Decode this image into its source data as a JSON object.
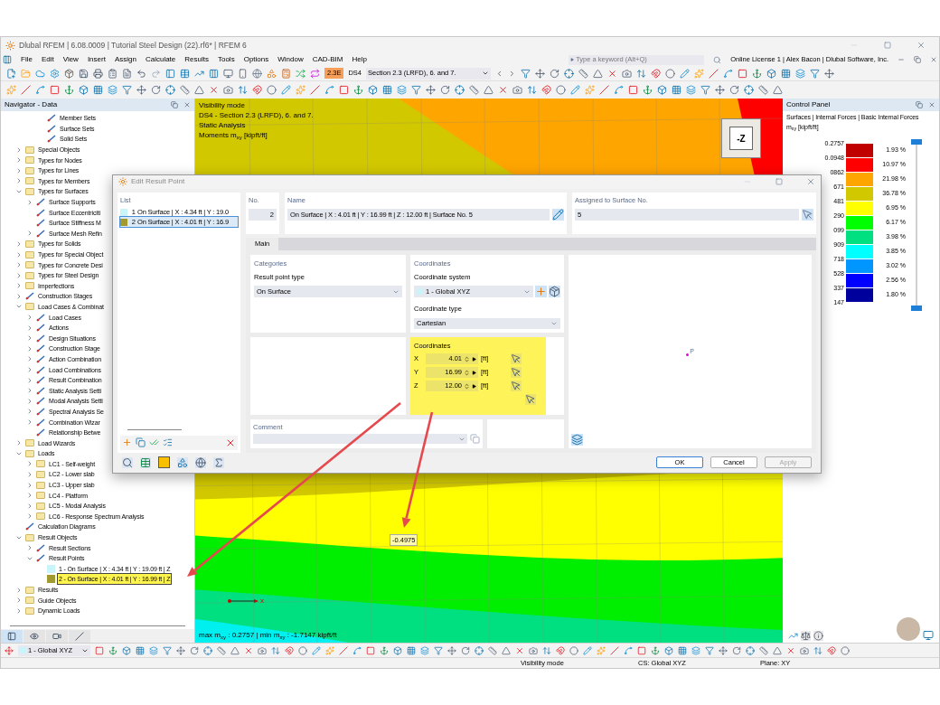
{
  "window": {
    "title": "Dlubal RFEM | 6.08.0009 | Tutorial Steel Design (22).rf6* | RFEM 6"
  },
  "menu": [
    "File",
    "Edit",
    "View",
    "Insert",
    "Assign",
    "Calculate",
    "Results",
    "Tools",
    "Options",
    "Window",
    "CAD-BIM",
    "Help"
  ],
  "search": {
    "placeholder": "Type a keyword (Alt+Q)"
  },
  "license": "Online License 1 | Alex Bacon | Dlubal Software, Inc.",
  "toolbar": {
    "badge": "2.3E",
    "design_situation": "DS4",
    "combo": "Section 2.3 (LRFD), 6. and 7."
  },
  "navigator": {
    "title": "Navigator - Data",
    "partial_items": [
      {
        "label": "Member Sets",
        "kind": "object"
      },
      {
        "label": "Surface Sets",
        "kind": "object"
      },
      {
        "label": "Solid Sets",
        "kind": "object"
      }
    ],
    "tree": [
      {
        "label": "Special Objects",
        "kind": "folder",
        "expanded": false
      },
      {
        "label": "Types for Nodes",
        "kind": "folder",
        "expanded": false
      },
      {
        "label": "Types for Lines",
        "kind": "folder",
        "expanded": false
      },
      {
        "label": "Types for Members",
        "kind": "folder",
        "expanded": false
      },
      {
        "label": "Types for Surfaces",
        "kind": "folder",
        "expanded": true,
        "children": [
          {
            "label": "Surface Supports",
            "kind": "object",
            "expanded": false
          },
          {
            "label": "Surface Eccentriciti",
            "kind": "object"
          },
          {
            "label": "Surface Stiffness M",
            "kind": "object"
          },
          {
            "label": "Surface Mesh Refin",
            "kind": "object",
            "expanded": false
          }
        ]
      },
      {
        "label": "Types for Solids",
        "kind": "folder",
        "expanded": false
      },
      {
        "label": "Types for Special Object",
        "kind": "folder",
        "expanded": false
      },
      {
        "label": "Types for Concrete Desi",
        "kind": "folder",
        "expanded": false
      },
      {
        "label": "Types for Steel Design",
        "kind": "folder",
        "expanded": false
      },
      {
        "label": "Imperfections",
        "kind": "folder",
        "expanded": false
      },
      {
        "label": "Construction Stages",
        "kind": "object",
        "expanded": false
      },
      {
        "label": "Load Cases & Combinat",
        "kind": "folder",
        "expanded": true,
        "children": [
          {
            "label": "Load Cases",
            "kind": "object",
            "expanded": false
          },
          {
            "label": "Actions",
            "kind": "object",
            "expanded": false
          },
          {
            "label": "Design Situations",
            "kind": "object",
            "expanded": false
          },
          {
            "label": "Construction Stage",
            "kind": "object",
            "expanded": false
          },
          {
            "label": "Action Combination",
            "kind": "object",
            "expanded": false
          },
          {
            "label": "Load Combinations",
            "kind": "object",
            "expanded": false
          },
          {
            "label": "Result Combination",
            "kind": "object",
            "expanded": false
          },
          {
            "label": "Static Analysis Setti",
            "kind": "object",
            "expanded": false
          },
          {
            "label": "Modal Analysis Setti",
            "kind": "object",
            "expanded": false
          },
          {
            "label": "Spectral Analysis Se",
            "kind": "object",
            "expanded": false
          },
          {
            "label": "Combination Wizar",
            "kind": "object",
            "expanded": false
          },
          {
            "label": "Relationship Betwe",
            "kind": "object"
          }
        ]
      },
      {
        "label": "Load Wizards",
        "kind": "folder",
        "expanded": false
      },
      {
        "label": "Loads",
        "kind": "folder",
        "expanded": true,
        "children": [
          {
            "label": "LC1 - Self-weight",
            "kind": "folder",
            "expanded": false
          },
          {
            "label": "LC2 - Lower slab",
            "kind": "folder",
            "expanded": false
          },
          {
            "label": "LC3 - Upper slab",
            "kind": "folder",
            "expanded": false
          },
          {
            "label": "LC4 - Platform",
            "kind": "folder",
            "expanded": false
          },
          {
            "label": "LC5 - Modal Analysis",
            "kind": "folder",
            "expanded": false
          },
          {
            "label": "LC6 - Response Spectrum Analysis",
            "kind": "folder",
            "expanded": false
          }
        ]
      },
      {
        "label": "Calculation Diagrams",
        "kind": "object"
      },
      {
        "label": "Result Objects",
        "kind": "folder",
        "expanded": true,
        "children": [
          {
            "label": "Result Sections",
            "kind": "object",
            "expanded": false
          },
          {
            "label": "Result Points",
            "kind": "object",
            "expanded": true,
            "children": [
              {
                "label": "1 - On Surface | X : 4.34 ft | Y : 19.09 ft | Z",
                "kind": "point",
                "color": "#c8f4fa",
                "selected": false
              },
              {
                "label": "2 - On Surface | X : 4.01 ft | Y : 16.99 ft | Z",
                "kind": "point",
                "color": "#a09a30",
                "selected": true
              }
            ]
          }
        ]
      },
      {
        "label": "Results",
        "kind": "folder",
        "expanded": false
      },
      {
        "label": "Guide Objects",
        "kind": "folder",
        "expanded": false
      },
      {
        "label": "Dynamic Loads",
        "kind": "folder",
        "expanded": false
      }
    ],
    "tabs": [
      {
        "selected": true
      },
      {
        "selected": false
      },
      {
        "selected": false
      },
      {
        "selected": false
      }
    ]
  },
  "viewport": {
    "info": [
      "Visibility mode",
      "DS4 - Section 2.3 (LRFD), 6. and 7.",
      "Static Analysis",
      "Moments m$_{xy}$ [kipft/ft]"
    ],
    "view_cube": "-Z",
    "result_label": "-0.4975",
    "axis_label": "x",
    "summary": "max m$_{xy}$ : 0.2757 | min m$_{xy}$ : -1.7147 kipft/ft"
  },
  "control_panel": {
    "title": "Control Panel",
    "path": "Surfaces | Internal Forces | Basic Internal Forces",
    "quantity": "m$_{xy}$ [kipft/ft]",
    "slider": {
      "level": 1
    },
    "values": [
      "0.2757",
      "0.0948",
      "0862",
      "671",
      "481",
      "290",
      "099",
      "909",
      "718",
      "528",
      "337",
      "147"
    ],
    "bands": [
      {
        "color": "#c00000",
        "percent": "1.93 %"
      },
      {
        "color": "#ff0000",
        "percent": "10.97 %"
      },
      {
        "color": "#ffa500",
        "percent": "21.98 %"
      },
      {
        "color": "#d2c800",
        "percent": "36.78 %"
      },
      {
        "color": "#ffff00",
        "percent": "6.95 %"
      },
      {
        "color": "#00ff00",
        "percent": "6.17 %"
      },
      {
        "color": "#00e080",
        "percent": "3.98 %"
      },
      {
        "color": "#00ffff",
        "percent": "3.85 %"
      },
      {
        "color": "#0096ff",
        "percent": "3.02 %"
      },
      {
        "color": "#0000ff",
        "percent": "2.56 %"
      },
      {
        "color": "#00009c",
        "percent": "1.80 %"
      }
    ]
  },
  "dialog": {
    "title": "Edit Result Point",
    "list_title": "List",
    "list": [
      {
        "no": "1",
        "label": "On Surface | X : 4.34 ft | Y : 19.0",
        "color": "#c8f4fa",
        "selected": false
      },
      {
        "no": "2",
        "label": "On Surface | X : 4.01 ft | Y : 16.9",
        "color": "#a09a30",
        "selected": true
      }
    ],
    "no": {
      "label": "No.",
      "value": "2"
    },
    "name": {
      "label": "Name",
      "value": "On Surface | X : 4.01 ft | Y : 16.99 ft | Z : 12.00 ft | Surface No. 5"
    },
    "assigned": {
      "label": "Assigned to Surface No.",
      "value": "5"
    },
    "tabs": [
      {
        "label": "Main",
        "selected": true
      }
    ],
    "categories": {
      "title": "Categories",
      "label": "Result point type",
      "value": "On Surface"
    },
    "coordinate_settings": {
      "title": "Coordinates",
      "system_label": "Coordinate system",
      "system": {
        "value": "1 - Global XYZ",
        "color": "#c8f4fa"
      },
      "type_label": "Coordinate type",
      "type": "Cartesian"
    },
    "coordinates": {
      "title": "Coordinates",
      "rows": [
        {
          "axis": "X",
          "value": "4.01",
          "unit": "[ft]"
        },
        {
          "axis": "Y",
          "value": "16.99",
          "unit": "[ft]"
        },
        {
          "axis": "Z",
          "value": "12.00",
          "unit": "[ft]"
        }
      ]
    },
    "preview": {
      "point_label": "P"
    },
    "comment": {
      "label": "Comment"
    },
    "buttons": [
      {
        "label": "OK",
        "default": true,
        "disabled": false
      },
      {
        "label": "Cancel",
        "default": false,
        "disabled": false
      },
      {
        "label": "Apply",
        "default": false,
        "disabled": true
      }
    ]
  },
  "bottom_toolbar": {
    "coordinate_system": "1 - Global XYZ",
    "color": "#c8f4fa"
  },
  "status_bar": [
    "Visibility mode",
    "CS: Global XYZ",
    "Plane: XY"
  ]
}
